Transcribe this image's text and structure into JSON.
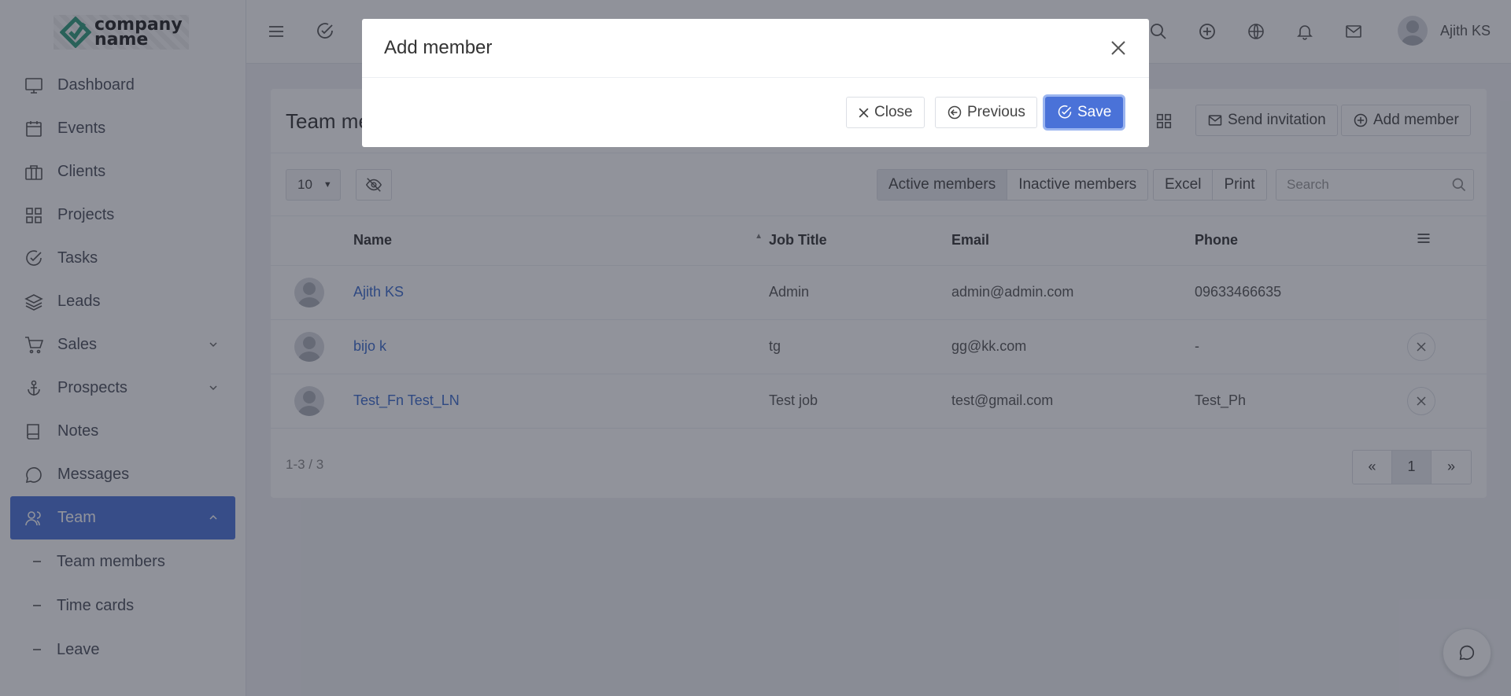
{
  "brand": {
    "line1": "company",
    "line2": "name"
  },
  "sidebar": {
    "items": [
      {
        "label": "Dashboard",
        "icon": "monitor-icon"
      },
      {
        "label": "Events",
        "icon": "calendar-icon"
      },
      {
        "label": "Clients",
        "icon": "briefcase-icon"
      },
      {
        "label": "Projects",
        "icon": "grid-icon"
      },
      {
        "label": "Tasks",
        "icon": "check-circle-icon"
      },
      {
        "label": "Leads",
        "icon": "layers-icon"
      },
      {
        "label": "Sales",
        "icon": "cart-icon"
      },
      {
        "label": "Prospects",
        "icon": "anchor-icon"
      },
      {
        "label": "Notes",
        "icon": "book-icon"
      },
      {
        "label": "Messages",
        "icon": "message-icon"
      },
      {
        "label": "Team",
        "icon": "users-icon"
      }
    ],
    "sub_items": [
      "Team members",
      "Time cards",
      "Leave"
    ]
  },
  "topbar": {
    "user_name": "Ajith KS"
  },
  "card": {
    "title": "Team members",
    "send_invitation": "Send invitation",
    "add_member": "Add member",
    "page_size": "10",
    "tab_active": "Active members",
    "tab_inactive": "Inactive members",
    "excel": "Excel",
    "print": "Print",
    "search_placeholder": "Search",
    "columns": {
      "name": "Name",
      "job": "Job Title",
      "email": "Email",
      "phone": "Phone"
    },
    "rows": [
      {
        "name": "Ajith KS",
        "job": "Admin",
        "email": "admin@admin.com",
        "phone": "09633466635"
      },
      {
        "name": "bijo k",
        "job": "tg",
        "email": "gg@kk.com",
        "phone": "-"
      },
      {
        "name": "Test_Fn Test_LN",
        "job": "Test job",
        "email": "test@gmail.com",
        "phone": "Test_Ph"
      }
    ],
    "count": "1-3 / 3",
    "page": "1"
  },
  "modal": {
    "title": "Add member",
    "close": "Close",
    "previous": "Previous",
    "save": "Save"
  },
  "colors": {
    "accent": "#4a72d8",
    "link": "#3b6bcc"
  }
}
